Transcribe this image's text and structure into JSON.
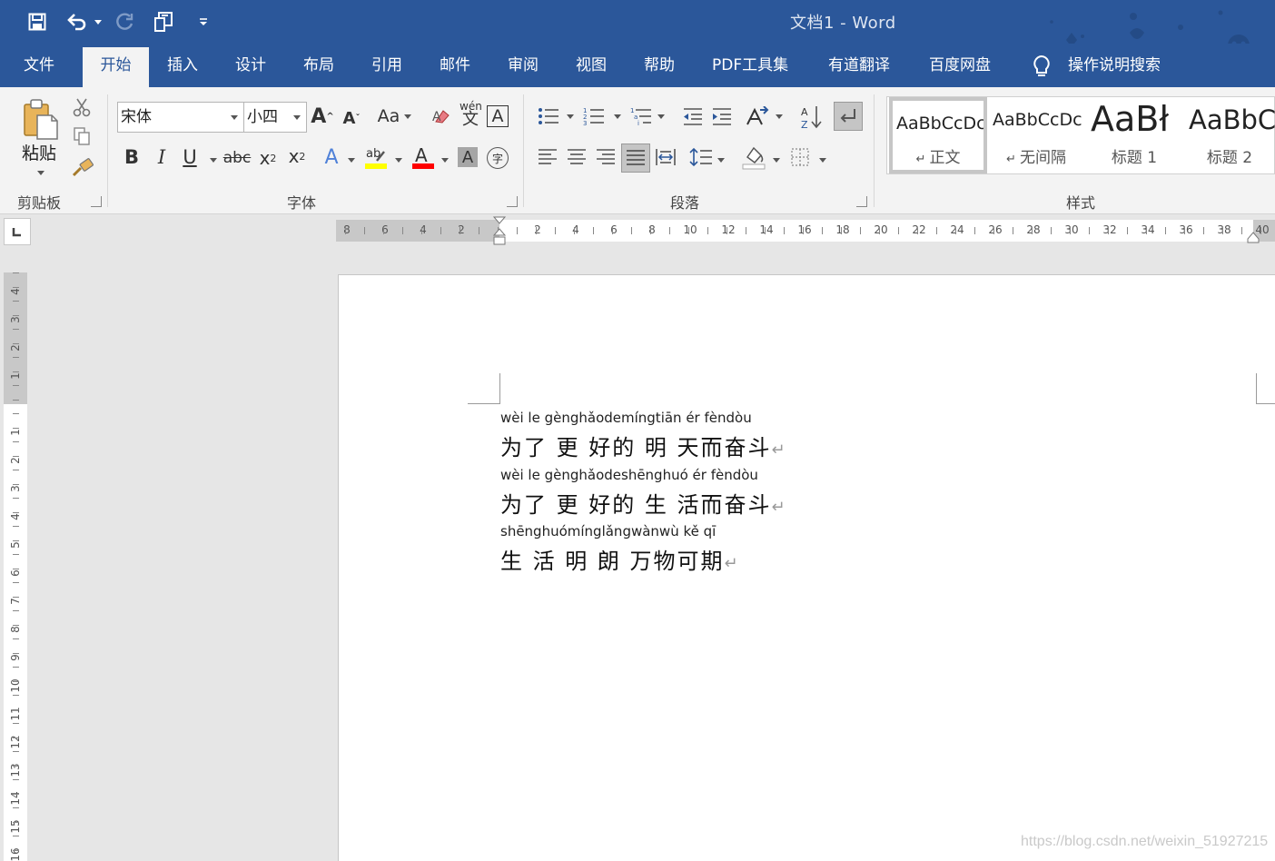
{
  "window": {
    "title": "文档1  -  Word"
  },
  "tabs": [
    "文件",
    "开始",
    "插入",
    "设计",
    "布局",
    "引用",
    "邮件",
    "审阅",
    "视图",
    "帮助",
    "PDF工具集",
    "有道翻译",
    "百度网盘"
  ],
  "active_tab": "开始",
  "tell_me": "操作说明搜索",
  "ribbon": {
    "clipboard": {
      "paste_label": "粘贴",
      "group_label": "剪贴板"
    },
    "font": {
      "font_name": "宋体",
      "font_size": "小四",
      "group_label": "字体",
      "phonetic_label": "wén",
      "phonetic_char": "文",
      "aa_label": "Aa",
      "strike_label": "abc"
    },
    "paragraph": {
      "group_label": "段落"
    },
    "styles": {
      "group_label": "样式",
      "items": [
        {
          "sample": "AaBbCcDc",
          "name": "正文"
        },
        {
          "sample": "AaBbCcDc",
          "name": "无间隔"
        },
        {
          "sample": "AaBł",
          "name": "标题 1"
        },
        {
          "sample": "AaBbC",
          "name": "标题 2"
        }
      ]
    }
  },
  "ruler": {
    "h_left": [
      "8",
      "6",
      "4",
      "2"
    ],
    "h_right": [
      "2",
      "4",
      "6",
      "8",
      "10",
      "12",
      "14",
      "16",
      "18",
      "20",
      "22",
      "24",
      "26",
      "28",
      "30",
      "32",
      "34",
      "36",
      "38",
      "40"
    ],
    "v_top": [
      "4",
      "3",
      "2",
      "1"
    ],
    "v_bottom": [
      "1",
      "2",
      "3",
      "4",
      "5",
      "6",
      "7",
      "8",
      "9",
      "10",
      "11",
      "12",
      "13",
      "14",
      "15",
      "16"
    ]
  },
  "document": {
    "lines": [
      {
        "pinyin": "wèi le gènghǎodemíngtiān ér fèndòu",
        "hanzi": "为了 更 好的 明 天而奋斗"
      },
      {
        "pinyin": "wèi le gènghǎodeshēnghuó ér fèndòu",
        "hanzi": "为了 更 好的 生 活而奋斗"
      },
      {
        "pinyin": "shēnghuómínglǎngwànwù kě  qī",
        "hanzi": " 生 活 明 朗 万物可期"
      }
    ],
    "paragraph_mark": "↵"
  },
  "watermark": "https://blog.csdn.net/weixin_51927215"
}
